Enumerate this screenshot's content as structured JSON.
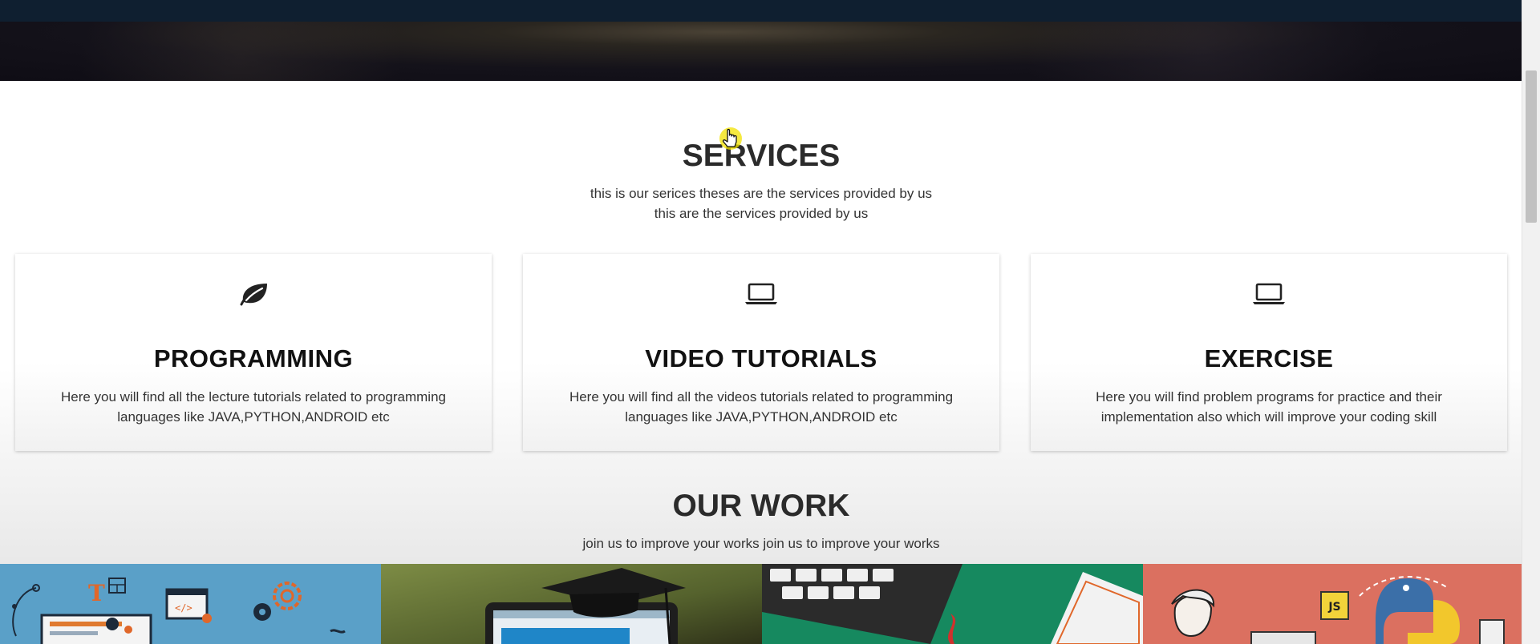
{
  "services": {
    "title": "SERVICES",
    "subtitle_line1": "this is our serices theses are the services provided by us",
    "subtitle_line2": "this are the services provided by us",
    "cards": [
      {
        "icon": "leaf-icon",
        "title": "PROGRAMMING",
        "description": "Here you will find all the lecture tutorials related to programming languages like JAVA,PYTHON,ANDROID etc"
      },
      {
        "icon": "laptop-icon",
        "title": "VIDEO TUTORIALS",
        "description": "Here you will find all the videos tutorials related to programming languages like JAVA,PYTHON,ANDROID etc"
      },
      {
        "icon": "laptop-icon",
        "title": "EXERCISE",
        "description": "Here you will find problem programs for practice and their implementation also which will improve your coding skill"
      }
    ]
  },
  "our_work": {
    "title": "OUR WORK",
    "subtitle": "join us to improve your works join us to improve your works",
    "tiles": [
      {
        "name": "web-design-illustration",
        "background": "#5aa0c8"
      },
      {
        "name": "graduation-cap-laptop-photo",
        "background": "#6b7a3a"
      },
      {
        "name": "java-keyboard-illustration",
        "background": "#16895f"
      },
      {
        "name": "python-js-illustration",
        "background": "#db7060",
        "badge": "JS"
      }
    ]
  },
  "colors": {
    "nav": "#0f1f30",
    "text_dark": "#2b2b2b",
    "cursor_highlight": "#f2e200"
  }
}
